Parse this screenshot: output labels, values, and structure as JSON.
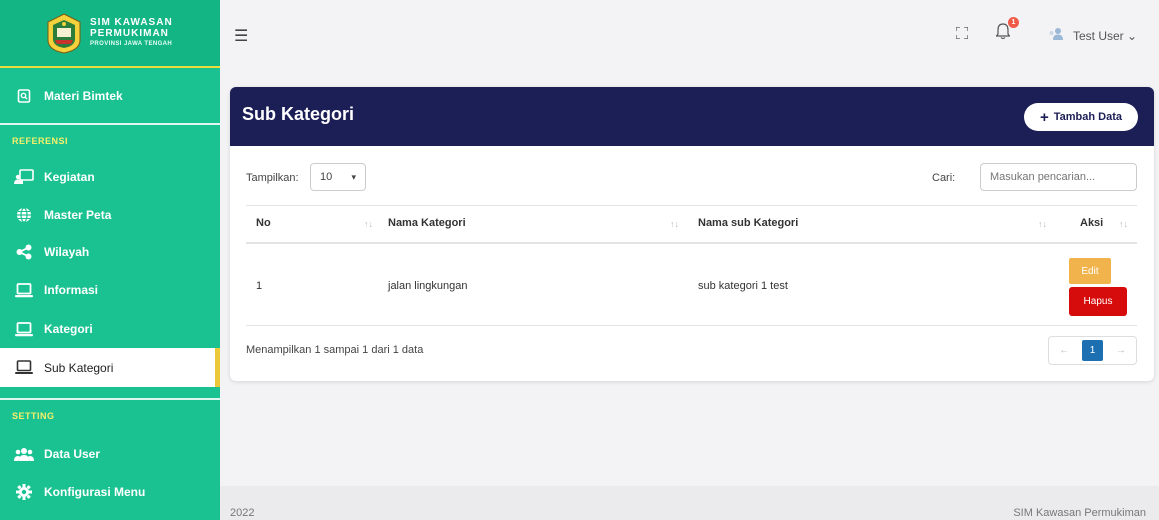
{
  "brand": {
    "line1": "SIM KAWASAN",
    "line2": "PERMUKIMAN",
    "line3": "PROVINSI JAWA TENGAH"
  },
  "sidebar": {
    "items": [
      {
        "label": "Materi Bimtek",
        "icon": "document-search-icon"
      },
      {
        "label": "Kegiatan",
        "icon": "presentation-board-icon"
      },
      {
        "label": "Master Peta",
        "icon": "globe-icon"
      },
      {
        "label": "Wilayah",
        "icon": "share-icon"
      },
      {
        "label": "Informasi",
        "icon": "laptop-icon"
      },
      {
        "label": "Kategori",
        "icon": "laptop-icon"
      },
      {
        "label": "Sub Kategori",
        "icon": "laptop-icon"
      },
      {
        "label": "Data User",
        "icon": "users-icon"
      },
      {
        "label": "Konfigurasi Menu",
        "icon": "gear-icon"
      }
    ],
    "sections": {
      "referensi": "REFERENSI",
      "setting": "SETTING"
    },
    "active": "Sub Kategori"
  },
  "topbar": {
    "user_name": "Test User ⌄",
    "notification_count": "1"
  },
  "card": {
    "title": "Sub Kategori",
    "add_button": "Tambah Data",
    "show_label": "Tampilkan:",
    "show_value": "10",
    "search_label": "Cari:",
    "search_placeholder": "Masukan pencarian...",
    "columns": [
      "No",
      "Nama Kategori",
      "Nama sub Kategori",
      "Aksi"
    ],
    "rows": [
      {
        "no": "1",
        "kategori": "jalan lingkungan",
        "sub_kategori": "sub kategori 1 test"
      }
    ],
    "edit_label": "Edit",
    "delete_label": "Hapus",
    "info": "Menampilkan 1 sampai 1 dari 1 data",
    "page": "1"
  },
  "footer": {
    "year": "2022",
    "app": "SIM Kawasan Permukiman"
  },
  "colors": {
    "sidebar": "#1bc291",
    "header": "#1c1e56",
    "edit": "#f1b44c",
    "delete": "#d60c0c",
    "active_border": "#ecc93a"
  }
}
